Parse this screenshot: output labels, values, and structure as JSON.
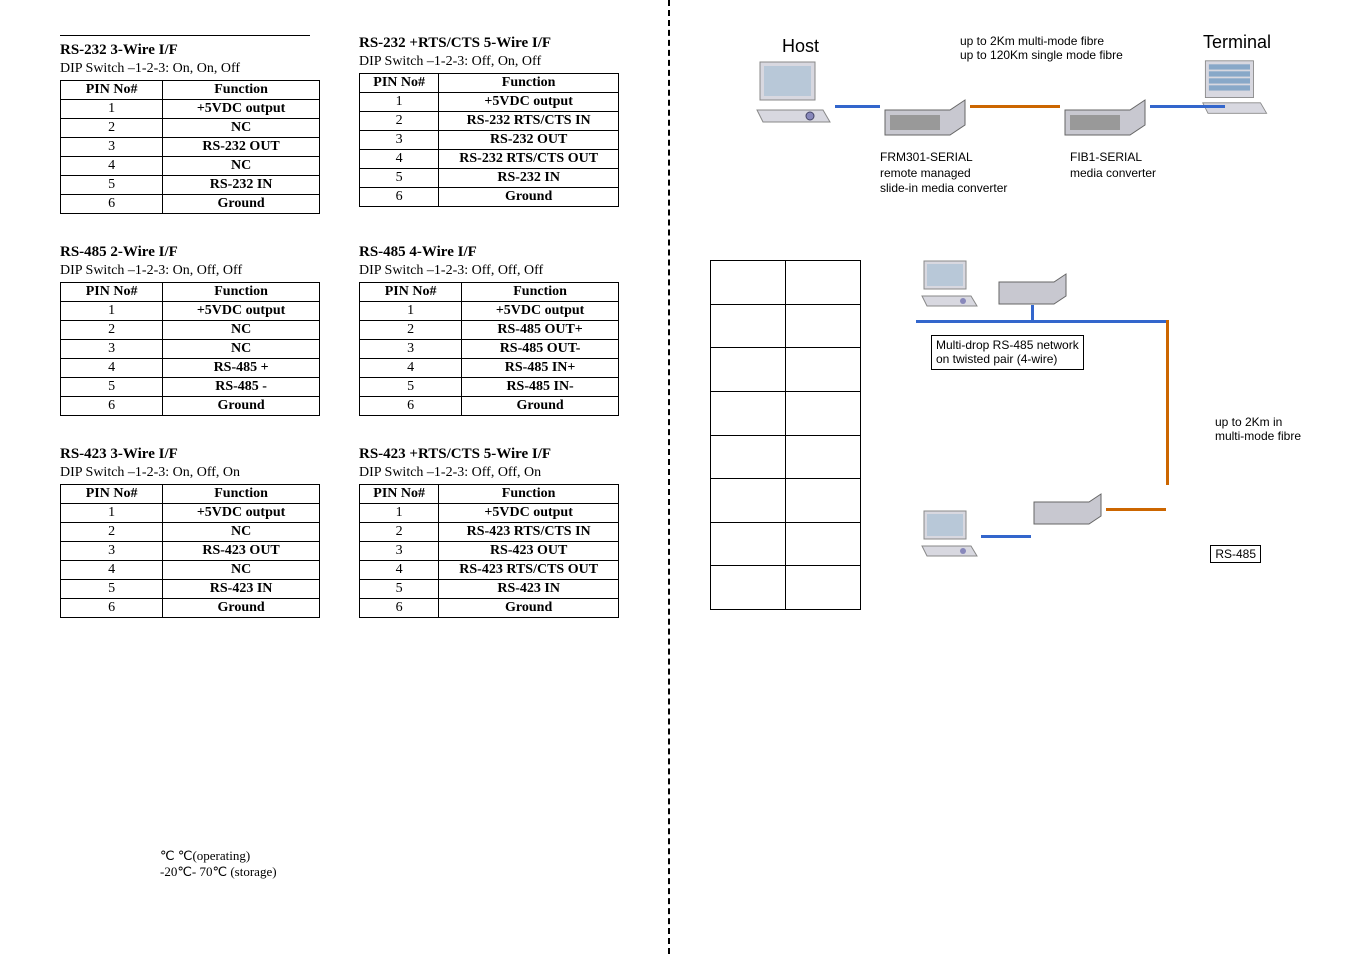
{
  "tables": [
    {
      "title": "RS-232 3-Wire I/F",
      "sub": "DIP Switch –1-2-3: On, On, Off",
      "header": [
        "PIN No#",
        "Function"
      ],
      "rows": [
        [
          "1",
          "+5VDC output"
        ],
        [
          "2",
          "NC"
        ],
        [
          "3",
          "RS-232 OUT"
        ],
        [
          "4",
          "NC"
        ],
        [
          "5",
          "RS-232 IN"
        ],
        [
          "6",
          "Ground"
        ]
      ],
      "hr": true
    },
    {
      "title": "RS-232 +RTS/CTS 5-Wire I/F",
      "sub": "DIP Switch –1-2-3: Off, On, Off",
      "header": [
        "PIN No#",
        "Function"
      ],
      "rows": [
        [
          "1",
          "+5VDC output"
        ],
        [
          "2",
          "RS-232 RTS/CTS IN"
        ],
        [
          "3",
          "RS-232 OUT"
        ],
        [
          "4",
          "RS-232 RTS/CTS OUT"
        ],
        [
          "5",
          "RS-232 IN"
        ],
        [
          "6",
          "Ground"
        ]
      ]
    },
    {
      "title": "RS-485 2-Wire I/F",
      "sub": "DIP Switch –1-2-3: On, Off, Off",
      "header": [
        "PIN No#",
        "Function"
      ],
      "rows": [
        [
          "1",
          "+5VDC output"
        ],
        [
          "2",
          "NC"
        ],
        [
          "3",
          "NC"
        ],
        [
          "4",
          "RS-485 +"
        ],
        [
          "5",
          "RS-485 -"
        ],
        [
          "6",
          "Ground"
        ]
      ]
    },
    {
      "title": "RS-485 4-Wire I/F",
      "sub": "DIP Switch –1-2-3: Off, Off, Off",
      "header": [
        "PIN No#",
        "Function"
      ],
      "rows": [
        [
          "1",
          "+5VDC output"
        ],
        [
          "2",
          "RS-485 OUT+"
        ],
        [
          "3",
          "RS-485 OUT-"
        ],
        [
          "4",
          "RS-485    IN+"
        ],
        [
          "5",
          "RS-485    IN-"
        ],
        [
          "6",
          "Ground"
        ]
      ]
    },
    {
      "title": "RS-423 3-Wire I/F",
      "sub": "DIP Switch –1-2-3: On, Off, On",
      "header": [
        "PIN No#",
        "Function"
      ],
      "rows": [
        [
          "1",
          "+5VDC output"
        ],
        [
          "2",
          "NC"
        ],
        [
          "3",
          "RS-423 OUT"
        ],
        [
          "4",
          "NC"
        ],
        [
          "5",
          "RS-423 IN"
        ],
        [
          "6",
          "Ground"
        ]
      ]
    },
    {
      "title": "RS-423 +RTS/CTS 5-Wire I/F",
      "sub": "DIP Switch –1-2-3: Off, Off, On",
      "header": [
        "PIN No#",
        "Function"
      ],
      "rows": [
        [
          "1",
          "+5VDC output"
        ],
        [
          "2",
          "RS-423 RTS/CTS IN"
        ],
        [
          "3",
          "RS-423 OUT"
        ],
        [
          "4",
          "RS-423 RTS/CTS OUT"
        ],
        [
          "5",
          "RS-423 IN"
        ],
        [
          "6",
          "Ground"
        ]
      ]
    }
  ],
  "temperature": {
    "line1": "℃      ℃(operating)",
    "line2": "-20℃- 70℃ (storage)"
  },
  "diagram1": {
    "host": "Host",
    "terminal": "Terminal",
    "fiber1": "up to 2Km multi-mode fibre",
    "fiber2": "up to 120Km single mode fibre",
    "frm_title": "FRM301-SERIAL",
    "frm_sub1": "remote managed",
    "frm_sub2": "slide-in media converter",
    "fib_title": "FIB1-SERIAL",
    "fib_sub": "media converter"
  },
  "diagram2": {
    "multidrop1": "Multi-drop RS-485 network",
    "multidrop2": "on twisted pair (4-wire)",
    "upto1": "up to 2Km in",
    "upto2": "multi-mode fibre",
    "rs485": "RS-485"
  },
  "blank_table": {
    "rows": 8,
    "cols": 2
  }
}
